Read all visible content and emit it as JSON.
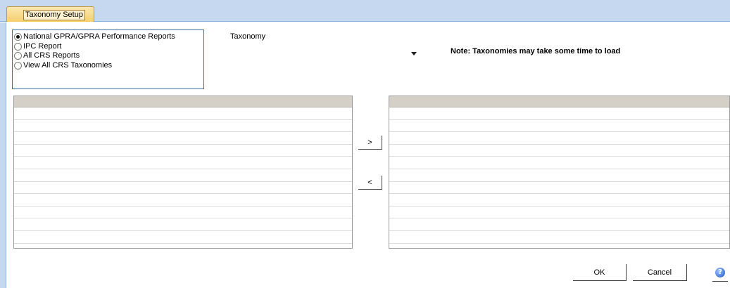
{
  "tab": {
    "label": "Taxonomy Setup"
  },
  "report_options": {
    "selected_index": 0,
    "items": [
      {
        "label": "National GPRA/GPRA Performance Reports",
        "checked": true
      },
      {
        "label": "IPC Report",
        "checked": false
      },
      {
        "label": "All CRS Reports",
        "checked": false
      },
      {
        "label": "View All CRS Taxonomies",
        "checked": false
      }
    ]
  },
  "taxonomy": {
    "label": "Taxonomy",
    "value": ""
  },
  "note": "Note:  Taxonomies may take some time to load",
  "transfer": {
    "add_label": ">",
    "remove_label": "<"
  },
  "footer": {
    "ok_label": "OK",
    "cancel_label": "Cancel",
    "help_icon_glyph": "?"
  },
  "colors": {
    "tab_strip": "#c5d8f0",
    "tab_active": "#f5cf6c",
    "grid_header": "#d4d0c8",
    "group_border": "#3a6e9e"
  },
  "icons": {
    "help": "help-icon",
    "dropdown": "chevron-down-icon"
  }
}
